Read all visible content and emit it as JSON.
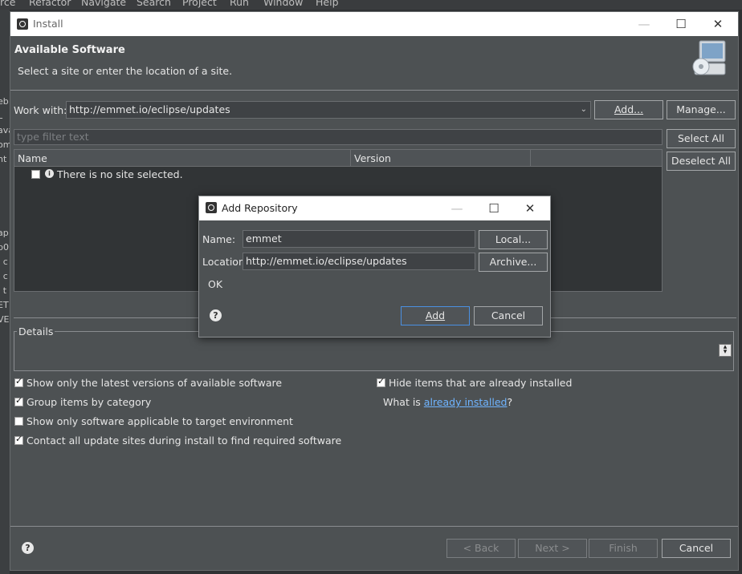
{
  "menu": [
    "rce",
    "Refactor",
    "Navigate",
    "Search",
    "Project",
    "Run",
    "Window",
    "Help"
  ],
  "left_strip": [
    "eb",
    "L",
    "ava",
    "om",
    "nt",
    "ap",
    "p0",
    "I c",
    "I c",
    "I t",
    "ET",
    "VE"
  ],
  "install": {
    "title": "Install",
    "header_title": "Available Software",
    "header_subtitle": "Select a site or enter the location of a site.",
    "work_with_label": "Work with:",
    "work_with_value": "http://emmet.io/eclipse/updates",
    "add_button": "Add...",
    "manage_button": "Manage...",
    "filter_placeholder": "type filter text",
    "select_all": "Select All",
    "deselect_all": "Deselect All",
    "columns": [
      "Name",
      "Version"
    ],
    "empty_row": "There is no site selected.",
    "details_label": "Details",
    "options_left": [
      {
        "label": "Show only the latest versions of available software",
        "checked": true
      },
      {
        "label": "Group items by category",
        "checked": true
      },
      {
        "label": "Show only software applicable to target environment",
        "checked": false
      },
      {
        "label": "Contact all update sites during install to find required software",
        "checked": true
      }
    ],
    "hide_installed": {
      "label": "Hide items that are already installed",
      "checked": true
    },
    "what_is_prefix": "What is",
    "already_installed_link": "already installed",
    "what_is_suffix": "?",
    "back_button": "< Back",
    "next_button": "Next >",
    "finish_button": "Finish",
    "cancel_button": "Cancel"
  },
  "dialog": {
    "title": "Add Repository",
    "name_label": "Name:",
    "name_value": "emmet",
    "local_button": "Local...",
    "location_label": "Location:",
    "location_value": "http://emmet.io/eclipse/updates",
    "archive_button": "Archive...",
    "status": "OK",
    "add_button": "Add",
    "cancel_button": "Cancel"
  },
  "colors": {
    "link": "#6fb4ff",
    "window_bg": "#4d5153",
    "titlebar_bg": "#ffffff"
  }
}
